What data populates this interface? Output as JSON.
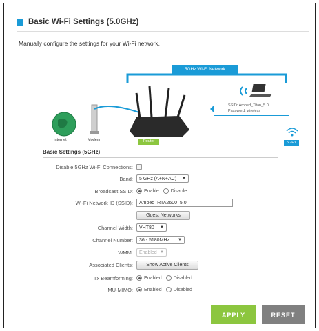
{
  "header": {
    "title": "Basic Wi-Fi Settings (5.0GHz)",
    "intro": "Manually configure the settings for your Wi-Fi network."
  },
  "diagram": {
    "network_label": "5GHz Wi-Fi Network",
    "ssid_line": "SSID: Amped_Titan_5.0",
    "password_line": "Password: wireless",
    "internet_label": "Internet",
    "modem_label": "Modem",
    "router_label": "Router",
    "band_label": "5GHz",
    "colors": {
      "blue": "#1a9bd7",
      "green": "#8cc63f"
    }
  },
  "section_title": "Basic Settings (5GHz)",
  "fields": {
    "disable_label": "Disable 5GHz Wi-Fi Connections:",
    "band_label": "Band:",
    "band_value": "5 GHz (A+N+AC)",
    "broadcast_label": "Broadcast SSID:",
    "broadcast_enable": "Enable",
    "broadcast_disable": "Disable",
    "ssid_label": "Wi-Fi Network ID (SSID):",
    "ssid_value": "Amped_RTA2600_5.0",
    "guest_button": "Guest Networks",
    "channel_width_label": "Channel Width:",
    "channel_width_value": "VHT80",
    "channel_number_label": "Channel Number:",
    "channel_number_value": "36 - 5180MHz",
    "wmm_label": "WMM:",
    "wmm_value": "Enabled",
    "clients_label": "Associated Clients:",
    "clients_button": "Show Active Clients",
    "tx_label": "Tx Beamforming:",
    "tx_enabled": "Enabled",
    "tx_disabled": "Disabled",
    "mumimo_label": "MU-MIMO:",
    "mumimo_enabled": "Enabled",
    "mumimo_disabled": "Disabled"
  },
  "actions": {
    "apply": "APPLY",
    "reset": "RESET"
  }
}
